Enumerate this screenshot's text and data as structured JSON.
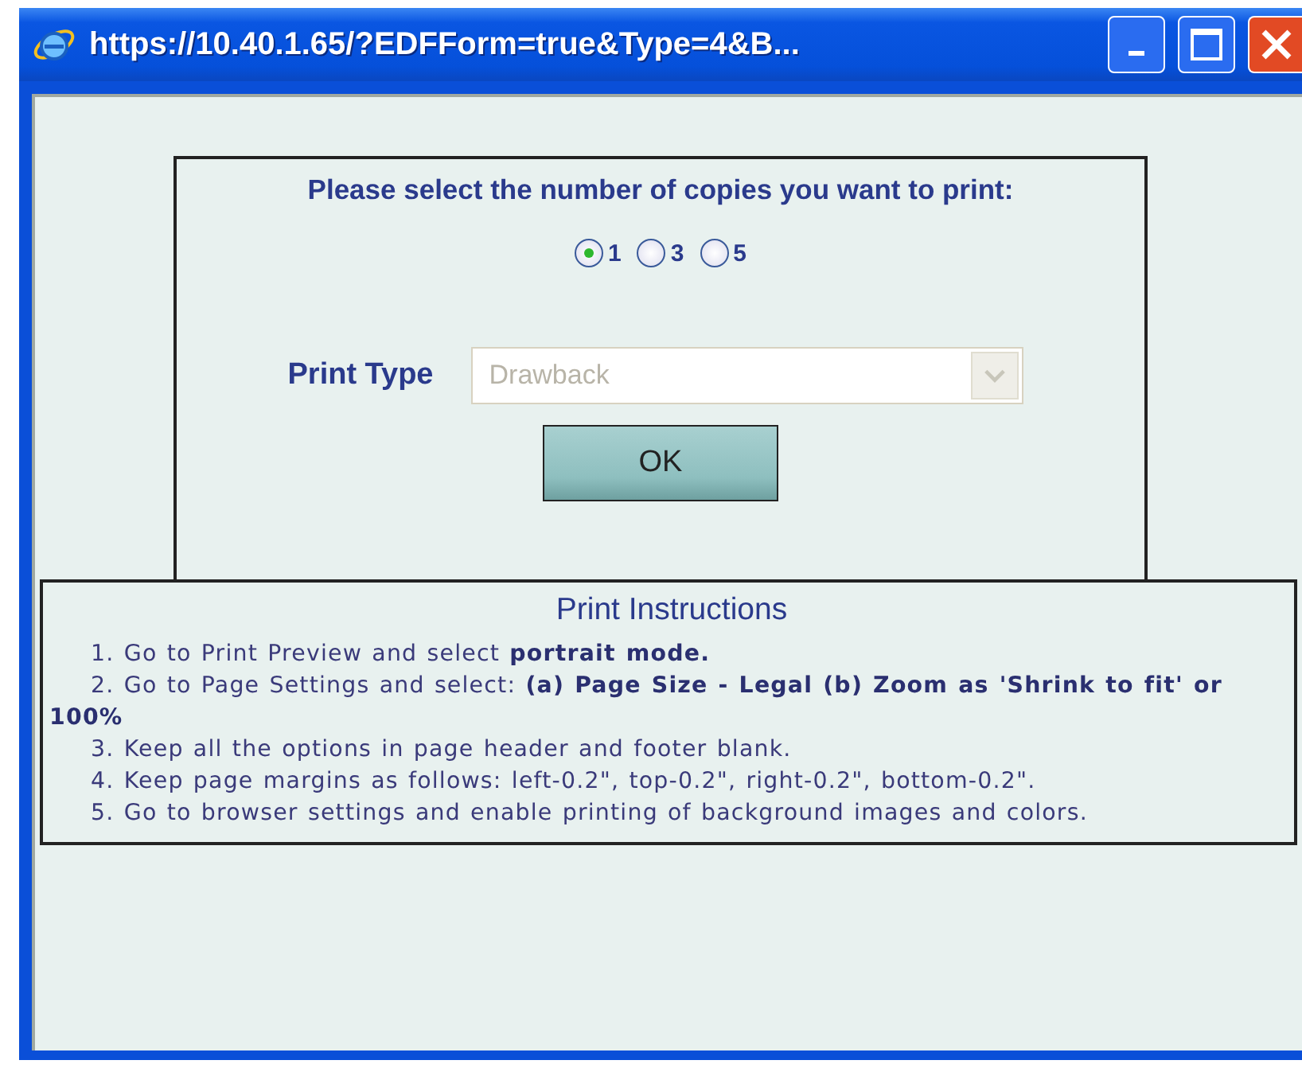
{
  "window": {
    "title": "https://10.40.1.65/?EDFForm=true&Type=4&B..."
  },
  "copies": {
    "prompt": "Please select the number of copies you want to print:",
    "options": [
      {
        "label": "1",
        "selected": true
      },
      {
        "label": "3",
        "selected": false
      },
      {
        "label": "5",
        "selected": false
      }
    ]
  },
  "print_type": {
    "label": "Print Type",
    "value": "Drawback",
    "disabled": true
  },
  "ok_button": "OK",
  "instructions": {
    "title": "Print Instructions",
    "items": [
      "1. Go to Print Preview and select **portrait mode.**",
      "2. Go to Page Settings and select: **(a) Page Size - Legal (b) Zoom as 'Shrink to fit' or 100%**",
      "3. Keep all the options in page header and footer blank.",
      "4. Keep page margins as follows: left-0.2\", top-0.2\", right-0.2\", bottom-0.2\".",
      "5. Go to browser settings and enable printing of background images and colors."
    ]
  }
}
